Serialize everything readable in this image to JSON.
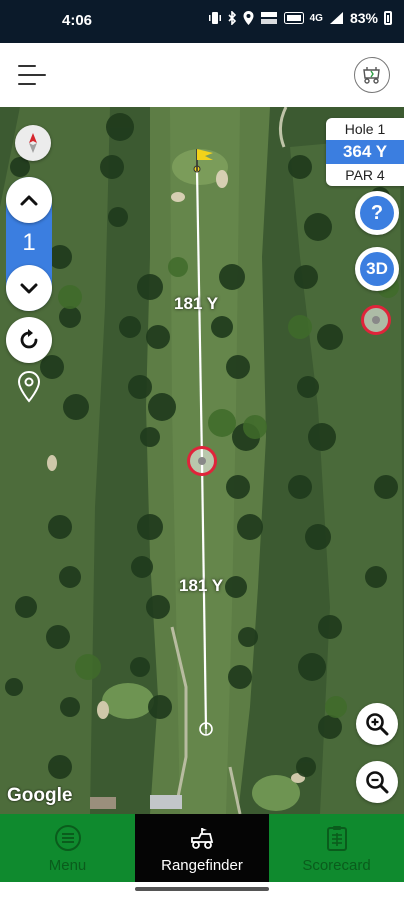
{
  "status_bar": {
    "time": "4:06",
    "signal_label": "4G",
    "battery_percent": "83%"
  },
  "header": {
    "menu_icon": "hamburger-icon",
    "logo_icon": "golf-app-logo"
  },
  "map": {
    "hole_control": {
      "hole_number": "1",
      "up_icon": "chevron-up-icon",
      "down_icon": "chevron-down-icon"
    },
    "hole_info": {
      "hole_label": "Hole 1",
      "yardage": "364 Y",
      "par_label": "PAR 4"
    },
    "help_label": "?",
    "view_3d_label": "3D",
    "distances": {
      "top_segment": "181 Y",
      "bottom_segment": "181 Y"
    },
    "attribution": "Google"
  },
  "bottom_nav": {
    "items": [
      {
        "label": "Menu",
        "icon": "menu-circle-icon",
        "active": false
      },
      {
        "label": "Rangefinder",
        "icon": "golf-cart-icon",
        "active": true
      },
      {
        "label": "Scorecard",
        "icon": "clipboard-icon",
        "active": false
      }
    ]
  },
  "colors": {
    "accent_blue": "#3b7ee0",
    "nav_green": "#0f8a2e",
    "marker_red": "#e0243a",
    "flag_yellow": "#f2d21b"
  }
}
